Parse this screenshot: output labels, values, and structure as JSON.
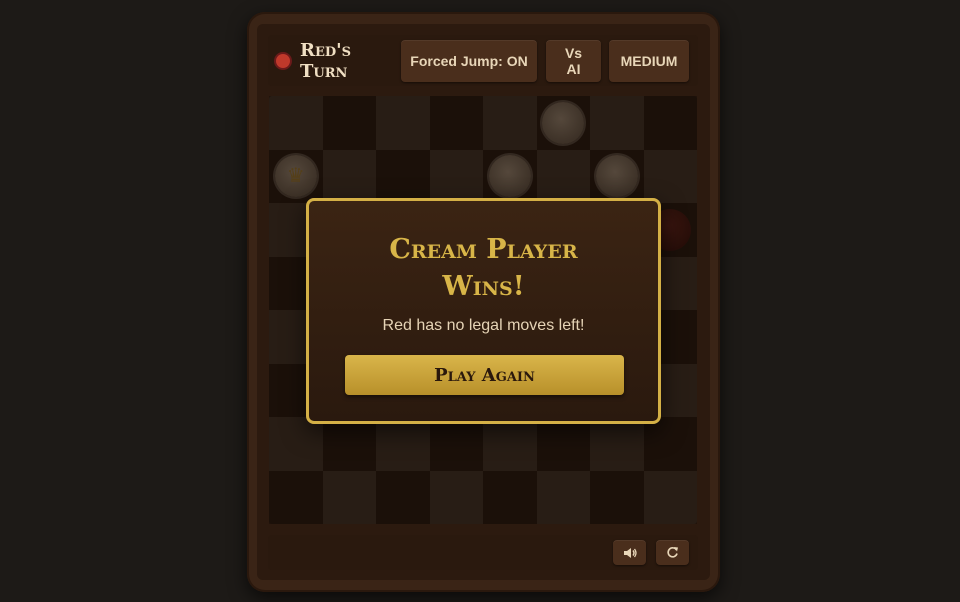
{
  "header": {
    "turn_label": "Red's Turn",
    "turn_color": "#c0392b",
    "forced_jump_label": "Forced Jump: ON",
    "mode_label": "Vs AI",
    "difficulty_label": "MEDIUM"
  },
  "board": {
    "size": 8,
    "light_color": "#3a2d22",
    "dark_color": "#22150c",
    "pieces": [
      {
        "row": 0,
        "col": 5,
        "color": "cream",
        "king": false
      },
      {
        "row": 1,
        "col": 0,
        "color": "cream",
        "king": true
      },
      {
        "row": 1,
        "col": 4,
        "color": "cream",
        "king": false
      },
      {
        "row": 1,
        "col": 6,
        "color": "cream",
        "king": false
      },
      {
        "row": 2,
        "col": 7,
        "color": "red",
        "king": false
      }
    ]
  },
  "modal": {
    "title": "Cream Player Wins!",
    "message": "Red has no legal moves left!",
    "button_label": "Play Again"
  },
  "footer": {
    "sound_icon": "speaker-icon",
    "restart_icon": "refresh-icon"
  }
}
